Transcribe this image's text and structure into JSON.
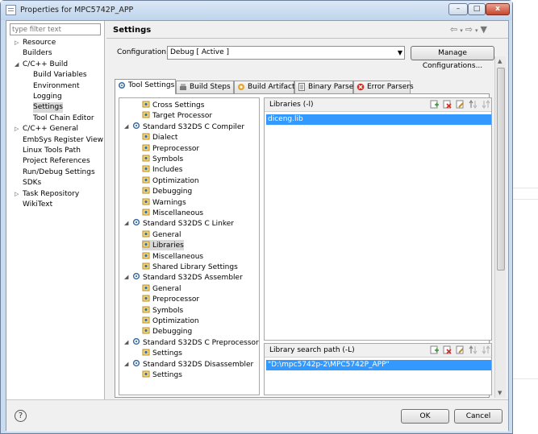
{
  "window": {
    "title": "Properties for MPC5742P_APP",
    "min": "–",
    "max": "□",
    "close": "x"
  },
  "filter": {
    "placeholder": "type filter text"
  },
  "nav": [
    {
      "label": "Resource",
      "expander": "▷"
    },
    {
      "label": "Builders"
    },
    {
      "label": "C/C++ Build",
      "expander": "◢"
    },
    {
      "label": "Build Variables"
    },
    {
      "label": "Environment"
    },
    {
      "label": "Logging"
    },
    {
      "label": "Settings"
    },
    {
      "label": "Tool Chain Editor"
    },
    {
      "label": "C/C++ General",
      "expander": "▷"
    },
    {
      "label": "EmbSys Register View"
    },
    {
      "label": "Linux Tools Path"
    },
    {
      "label": "Project References"
    },
    {
      "label": "Run/Debug Settings"
    },
    {
      "label": "SDKs"
    },
    {
      "label": "Task Repository",
      "expander": "▷"
    },
    {
      "label": "WikiText"
    }
  ],
  "page": {
    "title": "Settings",
    "config_label": "Configuration:",
    "config_value": "Debug  [ Active ]",
    "manage_button": "Manage Configurations...",
    "nav_back": "⇦",
    "nav_fwd": "⇨",
    "menu": "▼"
  },
  "tabs": [
    {
      "label": "Tool Settings"
    },
    {
      "label": "Build Steps"
    },
    {
      "label": "Build Artifact"
    },
    {
      "label": "Binary Parsers"
    },
    {
      "label": "Error Parsers"
    }
  ],
  "tool_tree": [
    {
      "label": "Cross Settings"
    },
    {
      "label": "Target Processor"
    },
    {
      "label": "Standard S32DS C Compiler",
      "expander": "◢"
    },
    {
      "label": "Dialect"
    },
    {
      "label": "Preprocessor"
    },
    {
      "label": "Symbols"
    },
    {
      "label": "Includes"
    },
    {
      "label": "Optimization"
    },
    {
      "label": "Debugging"
    },
    {
      "label": "Warnings"
    },
    {
      "label": "Miscellaneous"
    },
    {
      "label": "Standard S32DS C Linker",
      "expander": "◢"
    },
    {
      "label": "General"
    },
    {
      "label": "Libraries"
    },
    {
      "label": "Miscellaneous"
    },
    {
      "label": "Shared Library Settings"
    },
    {
      "label": "Standard S32DS Assembler",
      "expander": "◢"
    },
    {
      "label": "General"
    },
    {
      "label": "Preprocessor"
    },
    {
      "label": "Symbols"
    },
    {
      "label": "Optimization"
    },
    {
      "label": "Debugging"
    },
    {
      "label": "Standard S32DS C Preprocessor",
      "expander": "◢"
    },
    {
      "label": "Settings"
    },
    {
      "label": "Standard S32DS Disassembler",
      "expander": "◢"
    },
    {
      "label": "Settings"
    }
  ],
  "libraries": {
    "label": "Libraries (-l)",
    "items": [
      "diceng.lib"
    ]
  },
  "search_path": {
    "label": "Library search path (-L)",
    "items": [
      "\"D:\\mpc5742p-2\\MPC5742P_APP\""
    ]
  },
  "buttons": {
    "ok": "OK",
    "cancel": "Cancel",
    "help": "?"
  },
  "colors": {
    "selection": "#3399ff",
    "nav_selected": "#d9d9d9"
  }
}
